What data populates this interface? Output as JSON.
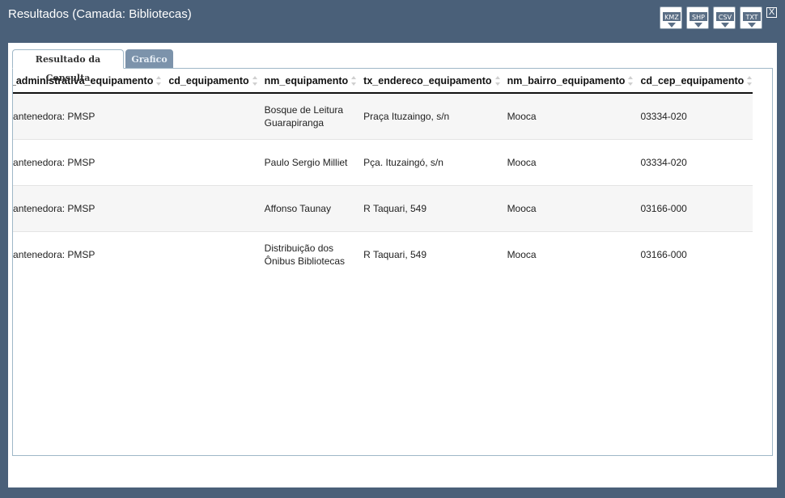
{
  "window": {
    "title": "Resultados (Camada: Bibliotecas)",
    "close_label": "X"
  },
  "export_buttons": [
    {
      "label": "KMZ",
      "icon": "kmz-download-icon"
    },
    {
      "label": "SHP",
      "icon": "shp-download-icon"
    },
    {
      "label": "CSV",
      "icon": "csv-download-icon"
    },
    {
      "label": "TXT",
      "icon": "txt-download-icon"
    }
  ],
  "tabs": [
    {
      "label": "Resultado da Consulta",
      "active": true
    },
    {
      "label": "Grafico",
      "active": false
    }
  ],
  "table": {
    "columns": [
      "tx_esfera_administrativa_equipamento",
      "cd_equipamento",
      "nm_equipamento",
      "tx_endereco_equipamento",
      "nm_bairro_equipamento",
      "cd_cep_equipamento"
    ],
    "rows": [
      {
        "esfera": "Unidade mantenedora: PMSP",
        "cd": "",
        "nm": "Bosque de Leitura Guarapiranga",
        "endereco": "Praça Ituzaingo, s/n",
        "bairro": "Mooca",
        "cep": "03334-020"
      },
      {
        "esfera": "Unidade mantenedora: PMSP",
        "cd": "",
        "nm": "Paulo Sergio Milliet",
        "endereco": "Pça. Ituzaingó, s/n",
        "bairro": "Mooca",
        "cep": "03334-020"
      },
      {
        "esfera": "Unidade mantenedora: PMSP",
        "cd": "",
        "nm": "Affonso Taunay",
        "endereco": "R Taquari, 549",
        "bairro": "Mooca",
        "cep": "03166-000"
      },
      {
        "esfera": "Unidade mantenedora: PMSP",
        "cd": "",
        "nm": "Distribuição dos Ônibus Bibliotecas",
        "endereco": "R Taquari, 549",
        "bairro": "Mooca",
        "cep": "03166-000"
      }
    ]
  }
}
